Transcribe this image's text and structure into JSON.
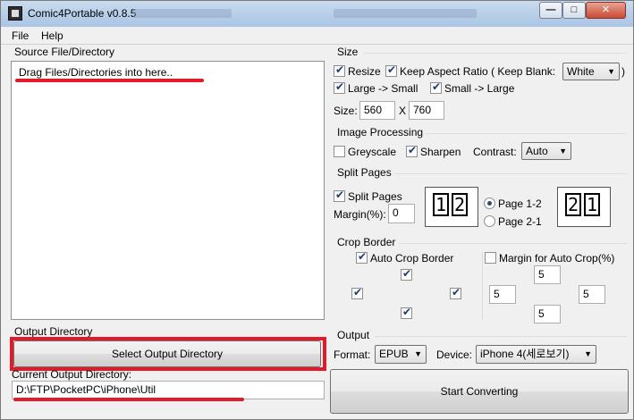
{
  "window": {
    "title": "Comic4Portable v0.8.5",
    "buttons": {
      "minimize": "—",
      "maximize": "□",
      "close": "✕"
    }
  },
  "menu": {
    "file": "File",
    "help": "Help"
  },
  "source": {
    "header": "Source File/Directory",
    "placeholder": "Drag Files/Directories into here.."
  },
  "output_dir": {
    "header": "Output Directory",
    "select_button": "Select Output Directory",
    "current_label": "Current Output Directory:",
    "current_value": "D:\\FTP\\PocketPC\\iPhone\\Util"
  },
  "size": {
    "header": "Size",
    "resize_label": "Resize",
    "resize_checked": true,
    "keep_aspect_label": "Keep Aspect Ratio ( Keep Blank:",
    "keep_aspect_checked": true,
    "blank_color": "White",
    "close_paren": ")",
    "large_small_label": "Large -> Small",
    "large_small_checked": true,
    "small_large_label": "Small -> Large",
    "small_large_checked": true,
    "size_label": "Size:",
    "width": "560",
    "x_label": "X",
    "height": "760"
  },
  "image_processing": {
    "header": "Image Processing",
    "greyscale_label": "Greyscale",
    "greyscale_checked": false,
    "sharpen_label": "Sharpen",
    "sharpen_checked": true,
    "contrast_label": "Contrast:",
    "contrast_value": "Auto"
  },
  "split_pages": {
    "header": "Split Pages",
    "split_label": "Split Pages",
    "split_checked": true,
    "margin_label": "Margin(%):",
    "margin_value": "0",
    "left_icon_digits": [
      "1",
      "2"
    ],
    "right_icon_digits": [
      "2",
      "1"
    ],
    "page12_label": "Page 1-2",
    "page12_checked": true,
    "page21_label": "Page 2-1",
    "page21_checked": false
  },
  "crop_border": {
    "header": "Crop Border",
    "auto_crop_label": "Auto Crop Border",
    "auto_crop_checked": true,
    "margin_auto_label": "Margin for Auto Crop(%)",
    "margin_auto_checked": false,
    "margin_top": "5",
    "margin_left": "5",
    "margin_right": "5",
    "margin_bottom": "5"
  },
  "output": {
    "header": "Output",
    "format_label": "Format:",
    "format_value": "EPUB",
    "device_label": "Device:",
    "device_value": "iPhone 4(세로보기)",
    "start_button": "Start Converting"
  },
  "colors": {
    "highlight": "#e21b2b",
    "window_bg": "#f0f0f0"
  }
}
